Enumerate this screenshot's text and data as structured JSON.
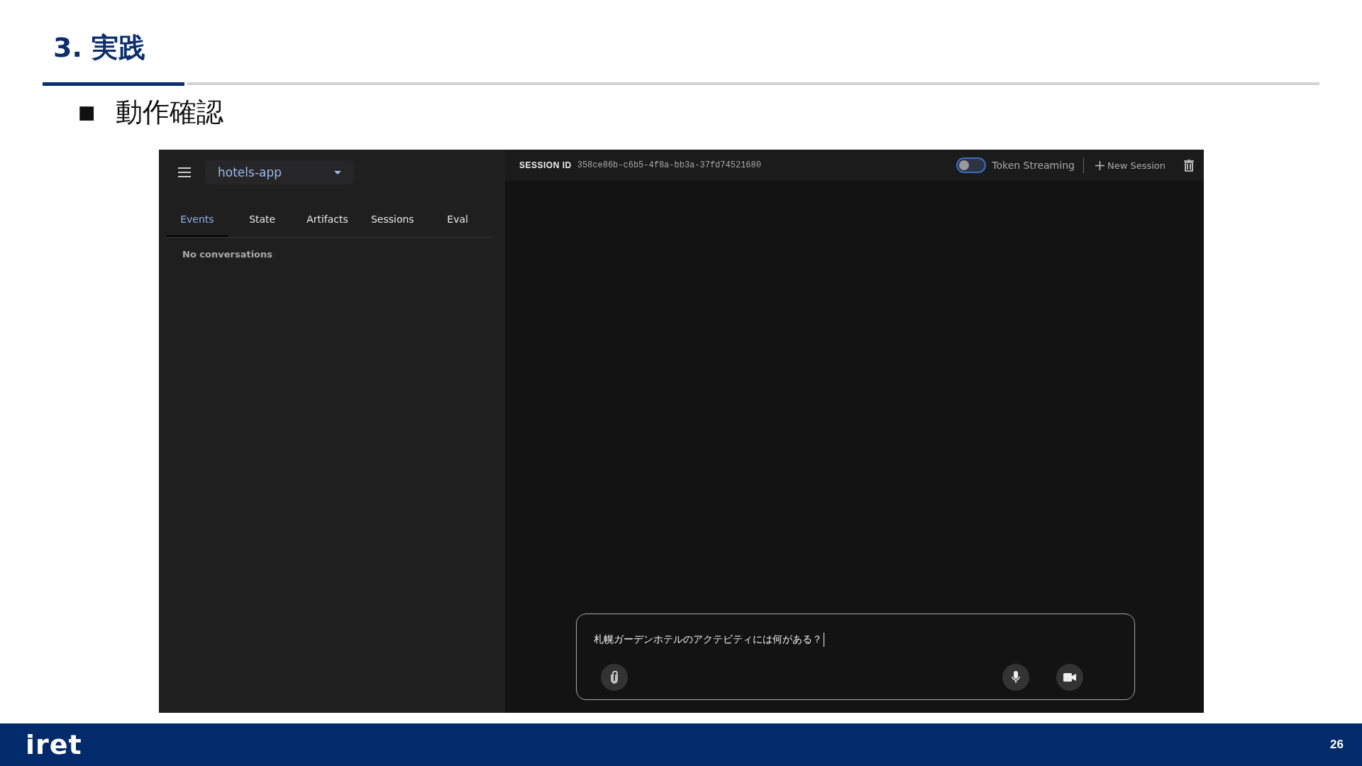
{
  "slide": {
    "title": "3. 実践",
    "bullet": "■",
    "heading": "動作確認"
  },
  "app": {
    "app_select": {
      "value": "hotels-app"
    },
    "tabs": [
      {
        "label": "Events",
        "selected": true
      },
      {
        "label": "State",
        "selected": false
      },
      {
        "label": "Artifacts",
        "selected": false
      },
      {
        "label": "Sessions",
        "selected": false
      },
      {
        "label": "Eval",
        "selected": false
      }
    ],
    "empty_message": "No conversations",
    "session": {
      "label": "SESSION ID",
      "id": "358ce86b-c6b5-4f8a-bb3a-37fd74521680"
    },
    "token_streaming": {
      "label": "Token Streaming",
      "on": false
    },
    "new_session": "New Session",
    "message_input": {
      "value": "札幌ガーデンホテルのアクテビティには何がある？"
    }
  },
  "footer": {
    "logo": "iret",
    "page_number": "26"
  }
}
